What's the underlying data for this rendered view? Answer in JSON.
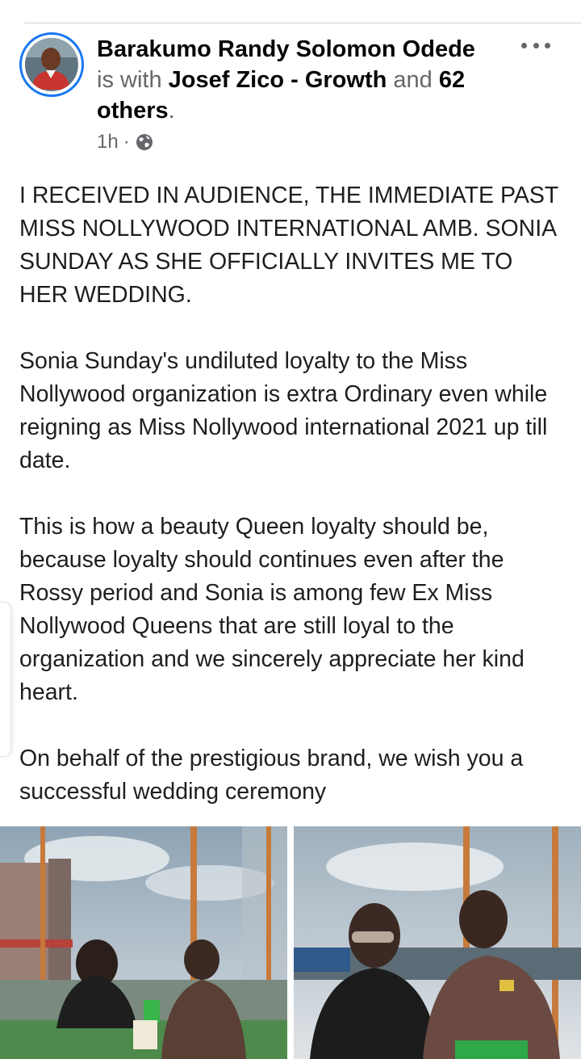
{
  "post": {
    "author": "Barakumo Randy Solomon Odede",
    "with_prefix": "is with",
    "tagged_person": "Josef Zico - Growth",
    "and_text": "and",
    "others_count": "62 others",
    "period": ".",
    "time": "1h",
    "meta_separator": "·",
    "privacy_icon": "globe-icon",
    "paragraphs": [
      "I RECEIVED IN AUDIENCE,  THE IMMEDIATE PAST MISS NOLLYWOOD INTERNATIONAL AMB. SONIA SUNDAY AS SHE  OFFICIALLY INVITES ME TO HER WEDDING.",
      "Sonia Sunday's undiluted loyalty to the Miss Nollywood organization is extra Ordinary even while reigning as Miss Nollywood international 2021 up till date.",
      "This is how a beauty Queen loyalty should be, because loyalty should continues even after the Rossy period  and Sonia is among few Ex Miss Nollywood Queens that are still loyal to the organization and we sincerely appreciate her kind heart.",
      "On behalf of the prestigious brand, we wish you a successful wedding ceremony"
    ]
  },
  "colors": {
    "avatar_ring": "#1877f2",
    "text_primary": "#050505",
    "text_secondary": "#65676b"
  }
}
